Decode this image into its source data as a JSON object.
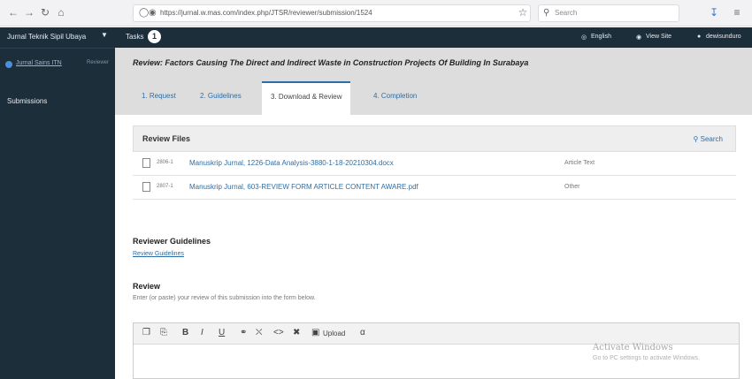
{
  "browser": {
    "url": "https://jurnal.w.mas.com/index.php/JTSR/reviewer/submission/1524",
    "search_placeholder": "Search",
    "nav_icons": [
      "back-icon",
      "forward-icon",
      "reload-icon",
      "home-icon"
    ]
  },
  "sidebar": {
    "journal_name": "Jurnal Teknik Sipil Ubaya",
    "user_name": "Jurnal Sains ITN",
    "user_role": "Reviewer",
    "items": [
      {
        "label": "Submissions"
      }
    ]
  },
  "topbar": {
    "tasks_label": "Tasks",
    "tasks_count": "1",
    "language": "English",
    "view_site": "View Site",
    "username": "dewisunduro"
  },
  "main": {
    "title": "Review: Factors Causing The Direct and Indirect Waste in Construction Projects Of Building In Surabaya",
    "tabs": [
      {
        "label": "1. Request"
      },
      {
        "label": "2. Guidelines"
      },
      {
        "label": "3. Download & Review"
      },
      {
        "label": "4. Completion"
      }
    ],
    "active_tab": 2,
    "review_files": {
      "title": "Review Files",
      "search_label": "Search",
      "files": [
        {
          "id": "2806-1",
          "name": "Manuskrip Jurnal, 1226-Data Analysis-3880-1-18-20210304.docx",
          "type": "Article Text"
        },
        {
          "id": "2807-1",
          "name": "Manuskrip Jurnal, 603-REVIEW FORM ARTICLE CONTENT AWARE.pdf",
          "type": "Other"
        }
      ]
    },
    "guidelines": {
      "title": "Reviewer Guidelines",
      "link": "Review Guidelines"
    },
    "review": {
      "title": "Review",
      "help": "Enter (or paste) your review of this submission into the form below.",
      "toolbar": {
        "upload_label": "Upload"
      }
    }
  },
  "watermark": {
    "line1": "Activate Windows",
    "line2": "Go to PC settings to activate Windows."
  },
  "colors": {
    "sidebar": "#1d2e3b",
    "link": "#2e6ea6",
    "band": "#dddddd"
  }
}
